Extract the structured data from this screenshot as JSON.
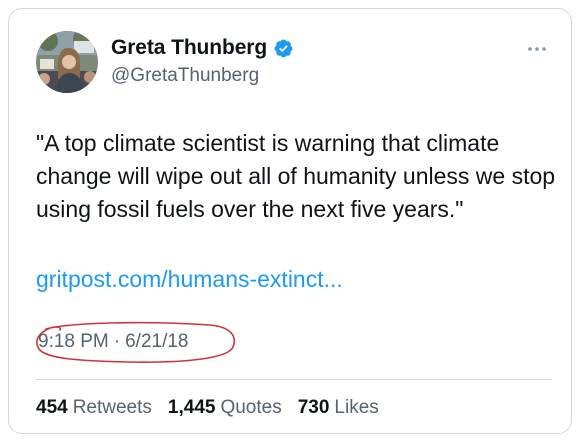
{
  "author": {
    "display_name": "Greta Thunberg",
    "handle": "@GretaThunberg",
    "verified": true
  },
  "tweet": {
    "text": "\"A top climate scientist is warning that climate change will wipe out all of humanity unless we stop using fossil fuels over the next five years.\"",
    "link": "gritpost.com/humans-extinct...",
    "time": "9:18 PM",
    "separator": "·",
    "date": "6/21/18"
  },
  "stats": {
    "retweets_count": "454",
    "retweets_label": "Retweets",
    "quotes_count": "1,445",
    "quotes_label": "Quotes",
    "likes_count": "730",
    "likes_label": "Likes"
  },
  "colors": {
    "link": "#1d9bf0",
    "secondary_text": "#536471",
    "verified_badge": "#1d9bf0",
    "annotation": "#d0323a"
  },
  "icons": {
    "verified": "verified-badge-icon",
    "more": "more-options-icon"
  }
}
